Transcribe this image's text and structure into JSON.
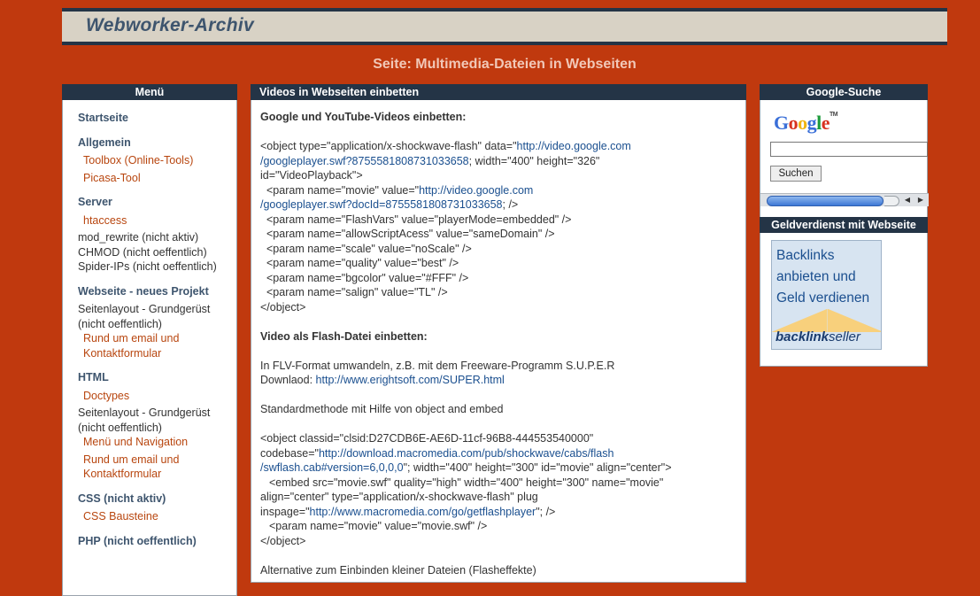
{
  "header": {
    "site_title": "Webworker-Archiv"
  },
  "page_title": "Seite: Multimedia-Dateien in Webseiten",
  "menu": {
    "title": "Menü",
    "items": [
      {
        "text": "Startseite",
        "type": "head"
      },
      {
        "text": "Allgemein",
        "type": "head"
      },
      {
        "text": "Toolbox (Online-Tools)",
        "type": "link"
      },
      {
        "text": "Picasa-Tool",
        "type": "link"
      },
      {
        "text": "Server",
        "type": "head"
      },
      {
        "text": "htaccess",
        "type": "link"
      },
      {
        "text": "mod_rewrite (nicht aktiv)",
        "type": "plain"
      },
      {
        "text": "CHMOD (nicht oeffentlich)",
        "type": "plain"
      },
      {
        "text": "Spider-IPs (nicht oeffentlich)",
        "type": "plain"
      },
      {
        "text": "Webseite - neues Projekt",
        "type": "head"
      },
      {
        "text": "Seitenlayout - Grundgerüst (nicht oeffentlich)",
        "type": "plain"
      },
      {
        "text": "Rund um email und Kontaktformular",
        "type": "link"
      },
      {
        "text": "HTML",
        "type": "head"
      },
      {
        "text": "Doctypes",
        "type": "link"
      },
      {
        "text": "Seitenlayout - Grundgerüst (nicht oeffentlich)",
        "type": "plain"
      },
      {
        "text": "Menü und Navigation",
        "type": "link"
      },
      {
        "text": "Rund um email und Kontaktformular",
        "type": "link"
      },
      {
        "text": "CSS (nicht aktiv)",
        "type": "head"
      },
      {
        "text": "CSS Bausteine",
        "type": "link"
      },
      {
        "text": "PHP (nicht oeffentlich)",
        "type": "head"
      }
    ]
  },
  "content": {
    "title": "Videos in Webseiten einbetten",
    "section1": "Google und YouTube-Videos einbetten:",
    "code1": {
      "l1a": "<object type=\"application/x-shockwave-flash\" data=\"",
      "l1b": "http://video.google.com",
      "l2a": "/googleplayer.swf?8755581808731033658",
      "l2b": "; width=\"400\" height=\"326\"",
      "l3": "id=\"VideoPlayback\">",
      "l4a": "<param name=\"movie\" value=\"",
      "l4b": "http://video.google.com",
      "l5a": "/googleplayer.swf?docId=8755581808731033658",
      "l5b": "; />",
      "l6": "<param name=\"FlashVars\" value=\"playerMode=embedded\" />",
      "l7": "<param name=\"allowScriptAcess\" value=\"sameDomain\" />",
      "l8": "<param name=\"scale\" value=\"noScale\" />",
      "l9": "<param name=\"quality\" value=\"best\" />",
      "l10": "<param name=\"bgcolor\" value=\"#FFF\" />",
      "l11": "<param name=\"salign\" value=\"TL\" />",
      "l12": "</object>"
    },
    "section2": "Video als Flash-Datei einbetten:",
    "flv_line": "In FLV-Format umwandeln, z.B. mit dem Freeware-Programm S.U.P.E.R",
    "download_label": "Downlaod: ",
    "download_link": "http://www.erightsoft.com/SUPER.html",
    "standard": "Standardmethode mit Hilfe von object and embed",
    "code2": {
      "l1": "<object classid=\"clsid:D27CDB6E-AE6D-11cf-96B8-444553540000\"",
      "l2a": "codebase=\"",
      "l2b": "http://download.macromedia.com/pub/shockwave/cabs/flash",
      "l3a": "/swflash.cab#version=6,0,0,0",
      "l3b": "\"; width=\"400\" height=\"300\" id=\"movie\" align=\"center\">",
      "l4": "<embed src=\"movie.swf\" quality=\"high\" width=\"400\" height=\"300\" name=\"movie\"",
      "l5": "align=\"center\" type=\"application/x-shockwave-flash\" plug",
      "l6a": "inspage=\"",
      "l6b": "http://www.macromedia.com/go/getflashplayer",
      "l6c": "\"; />",
      "l7": "<param name=\"movie\" value=\"movie.swf\" />",
      "l8": "</object>"
    },
    "alternative": "Alternative zum Einbinden kleiner Dateien (Flasheffekte)"
  },
  "search": {
    "title": "Google-Suche",
    "logo": "Google",
    "logo_tm": "TM",
    "button_label": "Suchen"
  },
  "earn": {
    "title": "Geldverdienst mit Webseite",
    "banner_line1": "Backlinks",
    "banner_line2": "anbieten und",
    "banner_line3": "Geld verdienen",
    "banner_brand_bold": "backlink",
    "banner_brand_light": "seller"
  }
}
